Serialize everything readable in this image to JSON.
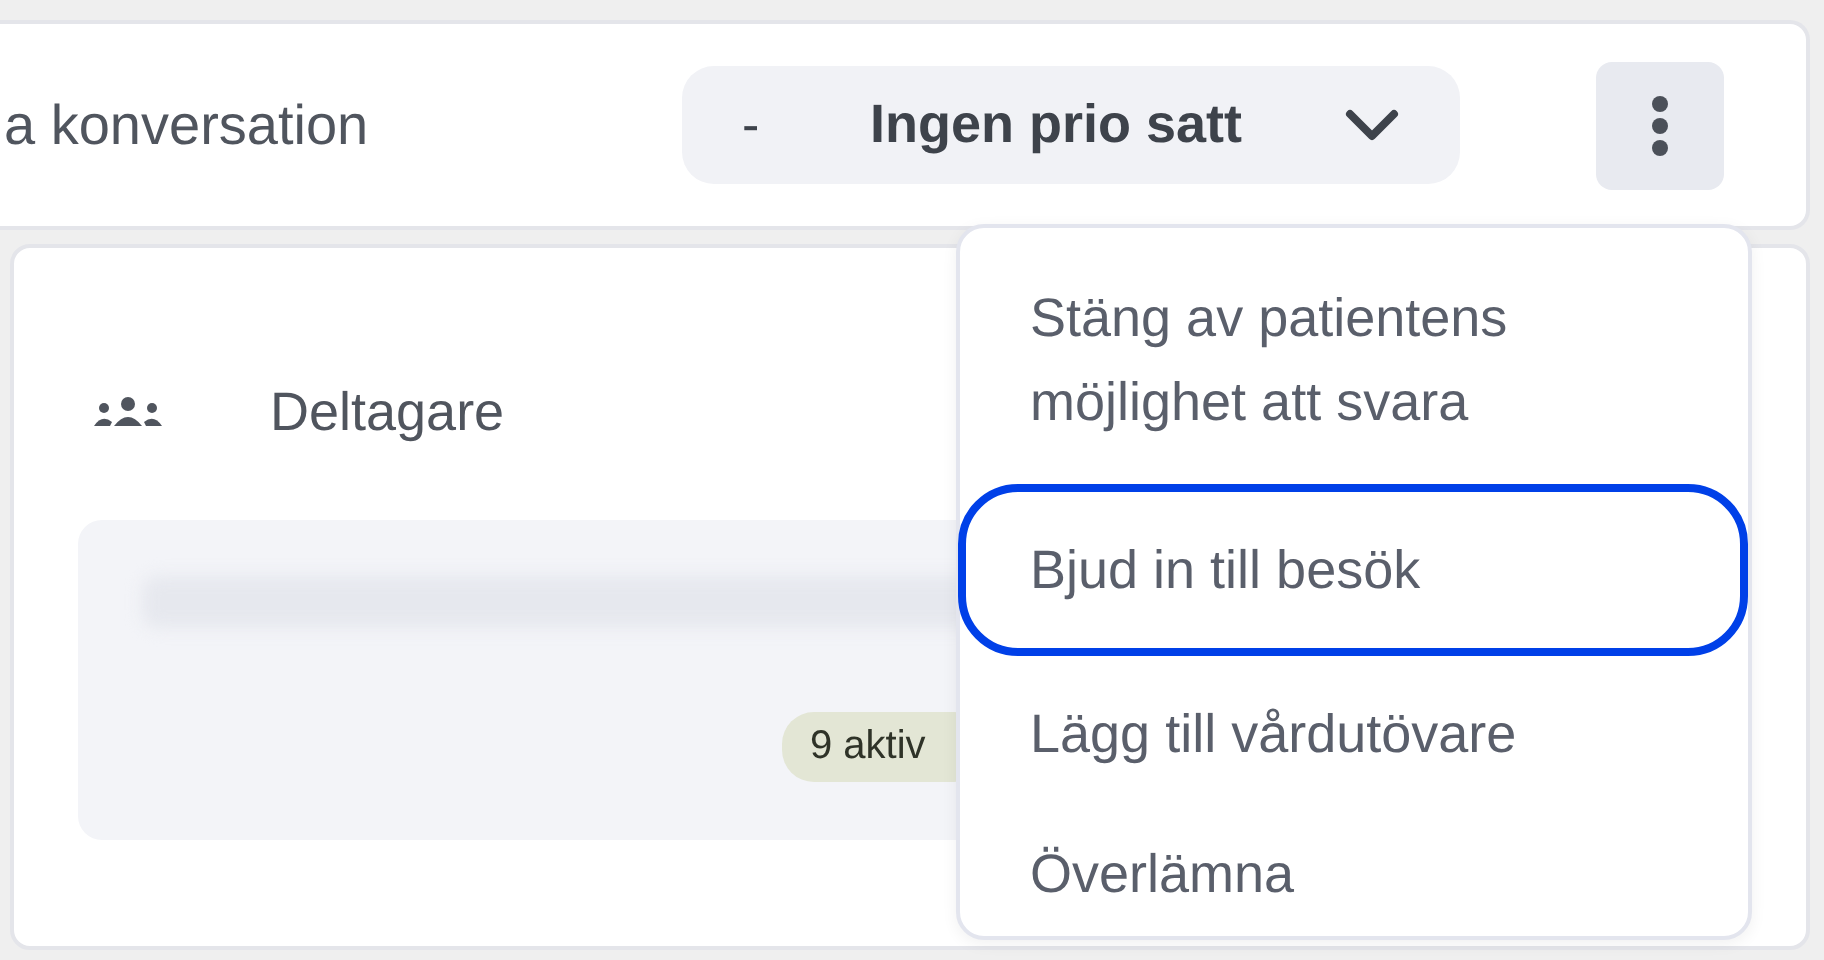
{
  "header": {
    "title": "a konversation",
    "priority": {
      "prefix": "-",
      "label": "Ingen prio satt"
    }
  },
  "participants": {
    "heading": "Deltagare",
    "badge": "9 aktiv"
  },
  "menu": {
    "items": [
      {
        "label": "Stäng av patientens möjlighet att svara",
        "focused": false
      },
      {
        "label": "Bjud in till besök",
        "focused": true
      },
      {
        "label": "Lägg till vårdutövare",
        "focused": false
      },
      {
        "label": "Överlämna",
        "focused": false
      }
    ]
  }
}
